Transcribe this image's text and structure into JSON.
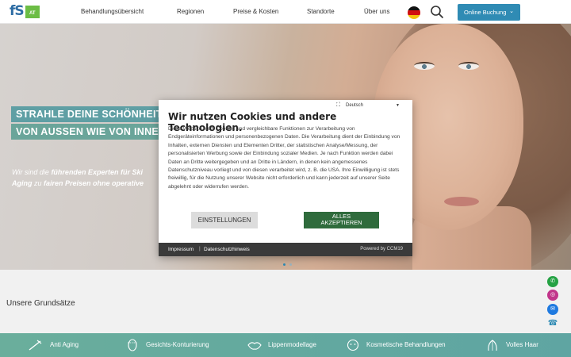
{
  "header": {
    "logo_text": "fS",
    "logo_suffix": "AT",
    "nav": [
      {
        "label": "Behandlungsübersicht"
      },
      {
        "label": "Regionen"
      },
      {
        "label": "Preise & Kosten"
      },
      {
        "label": "Standorte"
      },
      {
        "label": "Über uns"
      }
    ],
    "language_flag": "de-flag-icon",
    "booking_label": "Online Buchung"
  },
  "hero": {
    "headline_line1": "STRAHLE DEINE SCHÖNHEIT",
    "headline_line2": "VON AUSSEN WIE VON INNE",
    "subtitle_plain1": "Wir sind die ",
    "subtitle_bold1": "führenden Experten für Ski",
    "subtitle_bold2": "Aging",
    "subtitle_plain2": " zu ",
    "subtitle_bold3": "fairen Preisen ohne operative",
    "slider_dots": 2,
    "active_dot": 0
  },
  "cookie_modal": {
    "language": "Deutsch",
    "title": "Wir nutzen Cookies und andere Technologien.",
    "body": "Diese Website nutzt Cookies und vergleichbare Funktionen zur Verarbeitung von Endgeräteinformationen und personenbezogenen Daten. Die Verarbeitung dient der Einbindung von Inhalten, externen Diensten und Elementen Dritter, der statistischen Analyse/Messung, der personalisierten Werbung sowie der Einbindung sozialer Medien. Je nach Funktion werden dabei Daten an Dritte weitergegeben und an Dritte in Ländern, in denen kein angemessenes Datenschutzniveau vorliegt und von diesen verarbeitet wird, z. B. die USA. Ihre Einwilligung ist stets freiwillig, für die Nutzung unserer Website nicht erforderlich und kann jederzeit auf unserer Seite abgelehnt oder widerrufen werden.",
    "settings_button": "EINSTELLUNGEN",
    "accept_line1": "ALLES",
    "accept_line2": "AKZEPTIEREN",
    "footer_impressum": "Impressum",
    "footer_separator": "|",
    "footer_datenschutz": "Datenschutzhinweis",
    "powered_by": "Powered by CCM19"
  },
  "section": {
    "title": "Unsere Grundsätze"
  },
  "social": [
    {
      "icon": "whatsapp-icon",
      "color": "#25a244"
    },
    {
      "icon": "instagram-icon",
      "color": "#c1358a"
    },
    {
      "icon": "messenger-icon",
      "color": "#1f7ae0"
    },
    {
      "icon": "phone-icon",
      "color": "#2f8bb4"
    }
  ],
  "categories": [
    {
      "label": "Anti Aging",
      "icon": "syringe-icon"
    },
    {
      "label": "Gesichts-Konturierung",
      "icon": "face-contour-icon"
    },
    {
      "label": "Lippenmodellage",
      "icon": "lips-icon"
    },
    {
      "label": "Kosmetische Behandlungen",
      "icon": "cosmetic-face-icon"
    },
    {
      "label": "Volles Haar",
      "icon": "hair-icon"
    }
  ],
  "colors": {
    "accent_blue": "#2f8bb4",
    "accent_green": "#2f6b3c",
    "teal_bar": "#63a99f",
    "logo_green": "#6cbd45"
  }
}
